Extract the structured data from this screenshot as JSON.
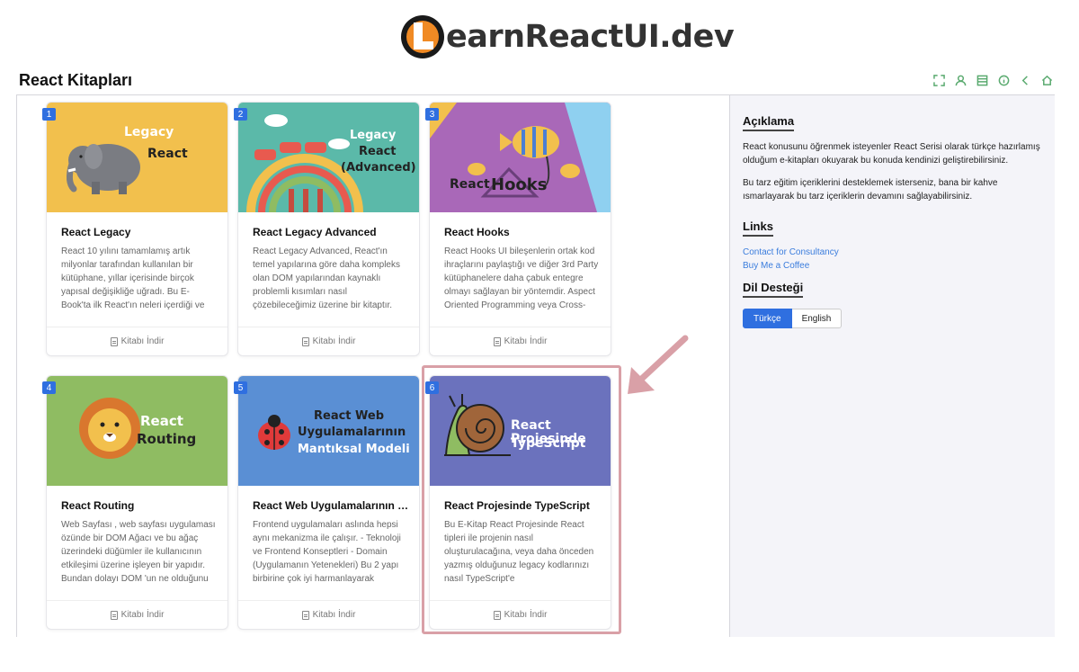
{
  "brand": {
    "logo_text": "earnReactUI.dev"
  },
  "page": {
    "title": "React Kitapları"
  },
  "toolbar": {
    "icons": [
      "fullscreen-icon",
      "user-icon",
      "table-icon",
      "info-icon",
      "back-icon",
      "home-icon"
    ]
  },
  "cards": [
    {
      "number": "1",
      "title": "React Legacy",
      "description": "React 10 yılını tamamlamış artık milyonlar tarafından kullanılan bir kütüphane, yıllar içerisinde birçok yapısal değişikliğe uğradı. Bu E-Book'ta ilk React'ın neleri içerdiği ve",
      "download": "Kitabı İndir",
      "cover_lines": [
        "Legacy",
        "React"
      ],
      "cover_color": "#f2c04d"
    },
    {
      "number": "2",
      "title": "React Legacy Advanced",
      "description": "React Legacy Advanced, React'ın temel yapılarına göre daha kompleks olan DOM yapılarından kaynaklı problemli kısımları nasıl çözebileceğimiz üzerine bir kitaptır.",
      "download": "Kitabı İndir",
      "cover_lines": [
        "Legacy",
        "React",
        "(Advanced)"
      ],
      "cover_color": "#5bb9a9"
    },
    {
      "number": "3",
      "title": "React Hooks",
      "description": "React Hooks UI bileşenlerin ortak kod ihraçlarını paylaştığı ve diğer 3rd Party kütüphanelere daha çabuk entegre olmayı sağlayan bir yöntemdir. Aspect Oriented Programming veya Cross-",
      "download": "Kitabı İndir",
      "cover_lines": [
        "React",
        "Hooks"
      ],
      "cover_color": "#a968b8"
    },
    {
      "number": "4",
      "title": "React Routing",
      "description": "Web Sayfası , web sayfası uygulaması özünde bir DOM Ağacı ve bu ağaç üzerindeki düğümler ile kullanıcının etkileşimi üzerine işleyen bir yapıdır. Bundan dolayı DOM 'un ne olduğunu",
      "download": "Kitabı İndir",
      "cover_lines": [
        "React",
        "Routing"
      ],
      "cover_color": "#8fbc62"
    },
    {
      "number": "5",
      "title": "React Web Uygulamalarının Ma...",
      "description": "Frontend uygulamaları aslında hepsi aynı mekanizma ile çalışır. - Teknoloji ve Frontend Konseptleri - Domain (Uygulamanın Yetenekleri) Bu 2 yapı birbirine çok iyi harmanlayarak",
      "download": "Kitabı İndir",
      "cover_lines": [
        "React Web",
        "Uygulamalarının",
        "Mantıksal Modeli"
      ],
      "cover_color": "#5a8fd4"
    },
    {
      "number": "6",
      "title": "React Projesinde TypeScript",
      "description": "Bu E-Kitap React Projesinde React tipleri ile projenin nasıl oluşturulacağına, veya daha önceden yazmış olduğunuz legacy kodlarınızı nasıl TypeScript'e",
      "download": "Kitabı İndir",
      "cover_lines": [
        "React Projesinde",
        "TypeScript"
      ],
      "cover_color": "#6b72bd"
    }
  ],
  "aside": {
    "description_heading": "Açıklama",
    "paragraph1": "React konusunu öğrenmek isteyenler React Serisi olarak türkçe hazırlamış olduğum e-kitapları okuyarak bu konuda kendinizi geliştirebilirsiniz.",
    "paragraph2": "Bu tarz eğitim içeriklerini desteklemek isterseniz, bana bir kahve ısmarlayarak bu tarz içeriklerin devamını sağlayabilirsiniz.",
    "links_heading": "Links",
    "link1": "Contact for Consultancy",
    "link2": "Buy Me a Coffee",
    "language_heading": "Dil Desteği",
    "lang_active": "Türkçe",
    "lang_inactive": "English"
  },
  "colors": {
    "accent": "#2f6fe0",
    "toolbar_icon": "#5aaa6f",
    "highlight": "#d9a0a7"
  }
}
